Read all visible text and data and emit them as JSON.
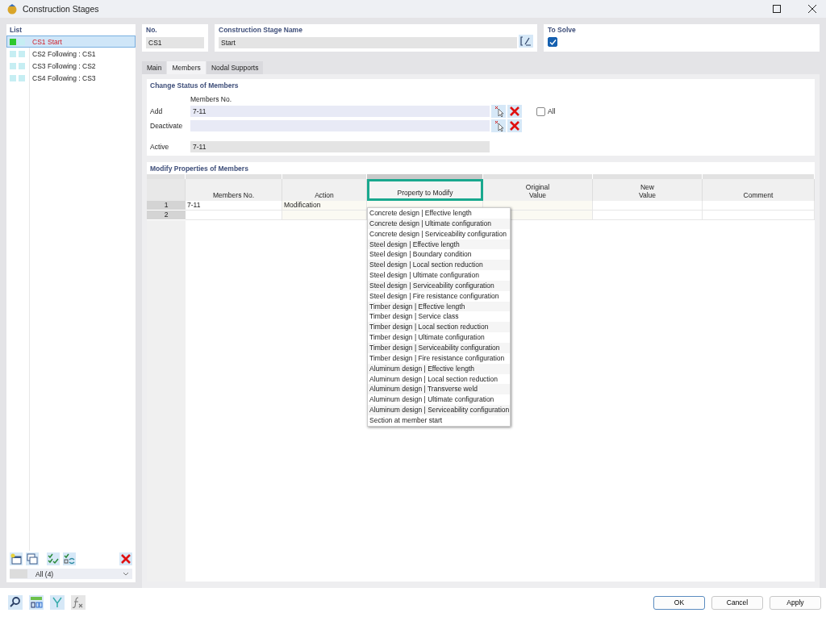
{
  "window": {
    "title": "Construction Stages"
  },
  "list": {
    "title": "List",
    "items": [
      {
        "no": "CS1",
        "name": "Start",
        "selected": true,
        "color": "#2fc82f"
      },
      {
        "no": "CS2",
        "name": "Following : CS1",
        "selected": false,
        "color": "#c6eef3"
      },
      {
        "no": "CS3",
        "name": "Following : CS2",
        "selected": false,
        "color": "#c6eef3"
      },
      {
        "no": "CS4",
        "name": "Following : CS3",
        "selected": false,
        "color": "#c6eef3"
      }
    ],
    "filter": "All (4)"
  },
  "header": {
    "no_label": "No.",
    "no_value": "CS1",
    "name_label": "Construction Stage Name",
    "name_value": "Start",
    "solve_label": "To Solve",
    "to_solve": true
  },
  "tabs": [
    {
      "label": "Main",
      "selected": false
    },
    {
      "label": "Members",
      "selected": true
    },
    {
      "label": "Nodal Supports",
      "selected": false
    }
  ],
  "status": {
    "title": "Change Status of Members",
    "column_label": "Members No.",
    "fields": [
      {
        "kind": "edit",
        "label": "Add",
        "value": "7-11"
      },
      {
        "kind": "edit",
        "label": "Deactivate"
      },
      {
        "kind": "readonly",
        "label": "Active",
        "value": "7-11"
      }
    ],
    "all_label": "All",
    "all_checked": false
  },
  "modify": {
    "title": "Modify Properties of Members",
    "columns": [
      {
        "label": "Members No.",
        "highlighted": false
      },
      {
        "label": "Action",
        "highlighted": false
      },
      {
        "label": "Property to Modify",
        "highlighted": true
      },
      {
        "label": "Original\nValue",
        "highlighted": false
      },
      {
        "label": "New\nValue",
        "highlighted": false
      },
      {
        "label": "Comment",
        "highlighted": false
      }
    ],
    "rows": [
      {
        "no": "1",
        "cells": [
          "7-11",
          "Modification"
        ]
      },
      {
        "no": "2"
      }
    ],
    "dropdown": [
      "Concrete design | Effective length",
      "Concrete design | Ultimate configuration",
      "Concrete design | Serviceability configuration",
      "Steel design | Effective length",
      "Steel design | Boundary condition",
      "Steel design | Local section reduction",
      "Steel design | Ultimate configuration",
      "Steel design | Serviceability configuration",
      "Steel design | Fire resistance configuration",
      "Timber design | Effective length",
      "Timber design | Service class",
      "Timber design | Local section reduction",
      "Timber design | Ultimate configuration",
      "Timber design | Serviceability configuration",
      "Timber design | Fire resistance configuration",
      "Aluminum design | Effective length",
      "Aluminum design | Local section reduction",
      "Aluminum design | Transverse weld",
      "Aluminum design | Ultimate configuration",
      "Aluminum design | Serviceability configuration",
      "Section at member start"
    ]
  },
  "buttons": [
    "OK",
    "Cancel",
    "Apply"
  ]
}
